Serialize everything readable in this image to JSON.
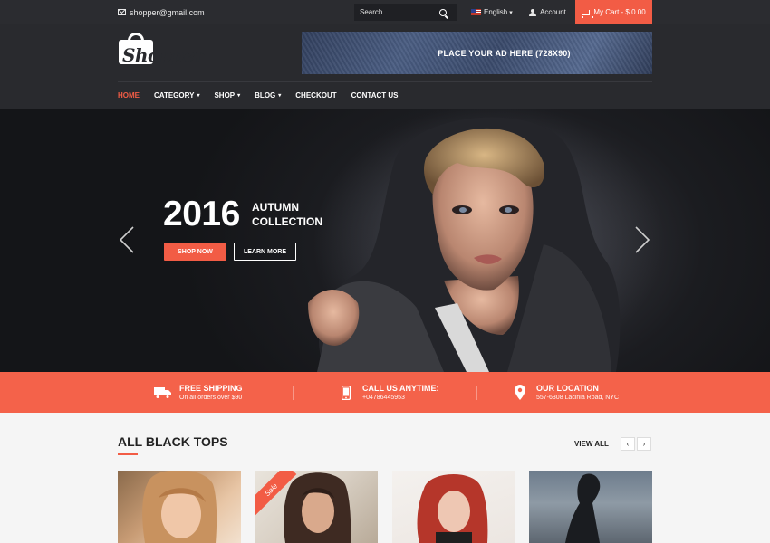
{
  "topbar": {
    "email": "shopper@gmail.com",
    "search_placeholder": "Search",
    "language": "English",
    "account": "Account",
    "cart": "My Cart - $ 0.00"
  },
  "header": {
    "logo_text": "Shopper",
    "ad_text": "PLACE YOUR AD HERE (728X90)"
  },
  "nav": {
    "items": [
      "HOME",
      "CATEGORY",
      "SHOP",
      "BLOG",
      "CHECKOUT",
      "CONTACT US"
    ],
    "active": "HOME"
  },
  "hero": {
    "year": "2016",
    "title_line1": "AUTUMN",
    "title_line2": "COLLECTION",
    "shop_button": "SHOP NOW",
    "learn_button": "LEARN MORE"
  },
  "features": [
    {
      "title": "FREE SHIPPING",
      "subtitle": "On all orders over $90",
      "icon": "truck-icon"
    },
    {
      "title": "CALL US ANYTIME:",
      "subtitle": "+04786445953",
      "icon": "phone-icon"
    },
    {
      "title": "OUR LOCATION",
      "subtitle": "557-6308 Lacinia Road, NYC",
      "icon": "location-pin-icon"
    }
  ],
  "section": {
    "title": "ALL BLACK TOPS",
    "view_all": "VIEW ALL",
    "prev": "‹",
    "next": "›"
  },
  "products": [
    {
      "badge": ""
    },
    {
      "badge": "Sale"
    },
    {
      "badge": ""
    },
    {
      "badge": ""
    }
  ],
  "colors": {
    "accent": "#f25c45",
    "topbar": "#2b2c30",
    "header": "#292a2e",
    "strip": "#f4624a"
  }
}
